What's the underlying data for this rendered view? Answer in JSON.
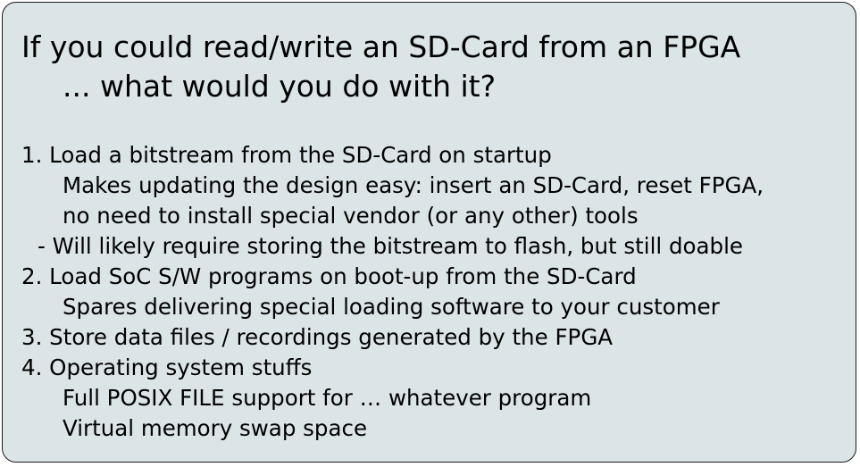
{
  "title": {
    "line1": "If you could read/write an SD-Card from an FPGA",
    "line2": "... what would you do with it?"
  },
  "items": [
    {
      "text": "1. Load a bitstream from the SD-Card on startup",
      "kind": "item"
    },
    {
      "text": "Makes updating the design easy: insert an SD-Card, reset FPGA,",
      "kind": "sub"
    },
    {
      "text": "no need to install special vendor (or any other) tools",
      "kind": "sub"
    },
    {
      "text": "- Will likely require storing the bitstream to flash, but still doable",
      "kind": "dash"
    },
    {
      "text": "2. Load SoC S/W programs on boot-up from the SD-Card",
      "kind": "item"
    },
    {
      "text": "Spares delivering special loading software to your customer",
      "kind": "sub"
    },
    {
      "text": "3. Store data files / recordings generated by the FPGA",
      "kind": "item"
    },
    {
      "text": "4. Operating system stuffs",
      "kind": "item"
    },
    {
      "text": "Full POSIX FILE support for … whatever program",
      "kind": "sub"
    },
    {
      "text": "Virtual memory swap space",
      "kind": "sub"
    }
  ],
  "colors": {
    "background": "#dbe4e7",
    "border": "#1a1a1a",
    "text": "#000000"
  }
}
